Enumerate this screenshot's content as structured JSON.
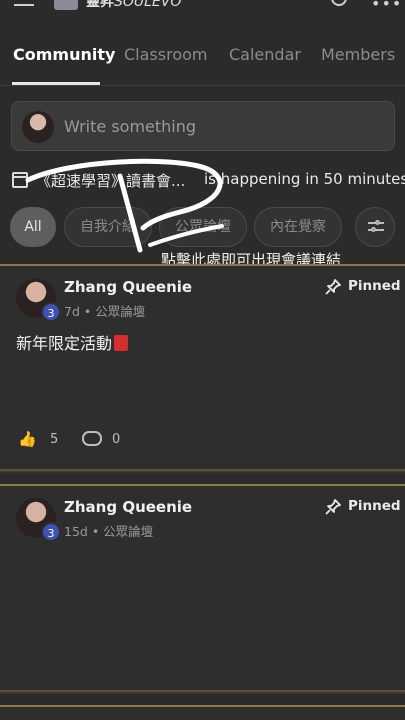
{
  "header": {
    "brand_bold": "靈昇",
    "brand_italic": "SOULEVO"
  },
  "tabs": [
    {
      "label": "Community",
      "active": true
    },
    {
      "label": "Classroom",
      "active": false
    },
    {
      "label": "Calendar",
      "active": false
    },
    {
      "label": "Members",
      "active": false
    }
  ],
  "composer": {
    "placeholder": "Write something"
  },
  "event": {
    "title": "《超速學習》讀書會...",
    "status": "is happening in 50 minutes"
  },
  "filters": [
    {
      "label": "All",
      "active": true
    },
    {
      "label": "自我介紹",
      "active": false
    },
    {
      "label": "公眾論壇",
      "active": false
    },
    {
      "label": "內在覺察",
      "active": false
    }
  ],
  "annotation": {
    "text": "點擊此處即可出現會議連結",
    "color": "#ffffff"
  },
  "posts": [
    {
      "author": "Zhang Queenie",
      "level": "3",
      "meta": "7d • 公眾論壇",
      "pinned_label": "Pinned",
      "body": "新年限定活動",
      "likes": "5",
      "comments": "0"
    },
    {
      "author": "Zhang Queenie",
      "level": "3",
      "meta": "15d • 公眾論壇",
      "pinned_label": "Pinned"
    }
  ],
  "colors": {
    "background": "#2b2b2b",
    "card_border_accent": "#8c7a4a",
    "level_badge": "#3f51b5",
    "like_icon": "#e0b24a"
  }
}
